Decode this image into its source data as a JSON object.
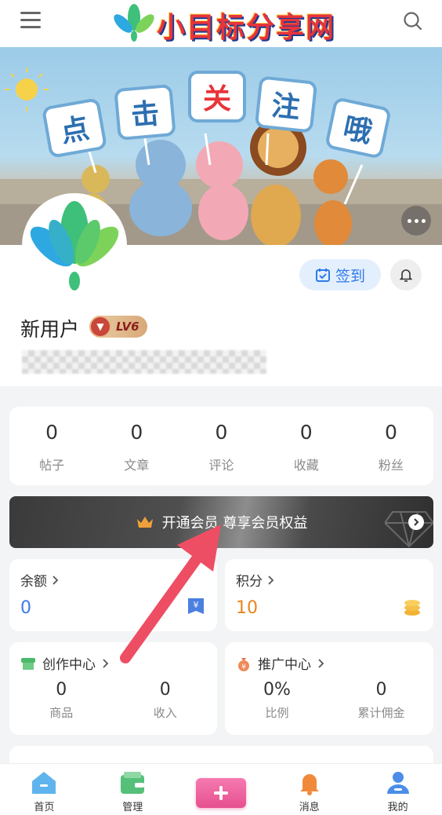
{
  "header": {
    "logo_text": "小目标分享网",
    "icons": {
      "menu": "menu-icon",
      "search": "search-icon",
      "logo": "lotus-logo-icon"
    }
  },
  "banner": {
    "signs": [
      "点",
      "击",
      "关",
      "注",
      "哦"
    ],
    "more_icon": "more-dots-icon"
  },
  "profile": {
    "username": "新用户",
    "level": "LV6",
    "checkin_label": "签到",
    "checkin_icon": "calendar-check-icon",
    "bell_icon": "bell-icon"
  },
  "stats": [
    {
      "value": "0",
      "label": "帖子"
    },
    {
      "value": "0",
      "label": "文章"
    },
    {
      "value": "0",
      "label": "评论"
    },
    {
      "value": "0",
      "label": "收藏"
    },
    {
      "value": "0",
      "label": "粉丝"
    }
  ],
  "vip": {
    "label": "开通会员 尊享会员权益",
    "icon": "crown-icon"
  },
  "balance": {
    "title": "余额",
    "value": "0",
    "value_color": "#3b7ae6",
    "icon": "yuan-wallet-icon"
  },
  "points": {
    "title": "积分",
    "value": "10",
    "value_color": "#e7851f",
    "icon": "coin-stack-icon"
  },
  "creator": {
    "title": "创作中心",
    "icon": "shop-icon",
    "items": [
      {
        "value": "0",
        "label": "商品"
      },
      {
        "value": "0",
        "label": "收入"
      }
    ]
  },
  "promo": {
    "title": "推广中心",
    "icon": "money-bag-icon",
    "items": [
      {
        "value": "0%",
        "label": "比例"
      },
      {
        "value": "0",
        "label": "累计佣金"
      }
    ]
  },
  "tabbar": [
    {
      "label": "首页",
      "icon": "home-icon"
    },
    {
      "label": "管理",
      "icon": "wallet-icon"
    },
    {
      "label": "",
      "icon": "plus-icon"
    },
    {
      "label": "消息",
      "icon": "bell-icon"
    },
    {
      "label": "我的",
      "icon": "user-icon"
    }
  ],
  "colors": {
    "accent": "#2e7be8",
    "vip_bg": "#444444",
    "plus": "#e6508f",
    "arrow": "#ee4e63"
  }
}
